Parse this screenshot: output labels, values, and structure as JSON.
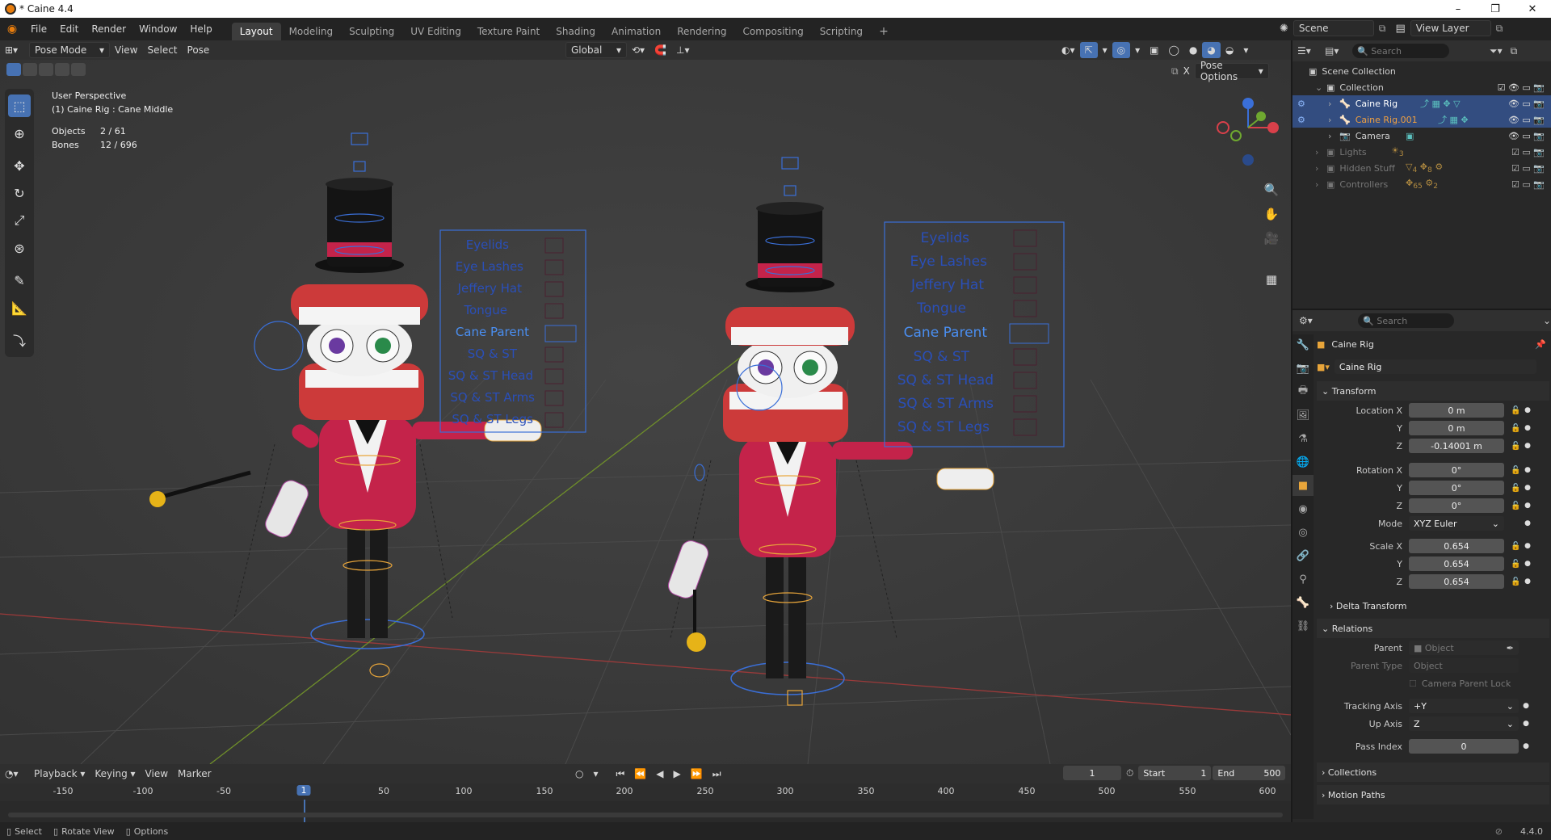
{
  "window": {
    "title": "* Caine 4.4"
  },
  "menus": [
    "File",
    "Edit",
    "Render",
    "Window",
    "Help"
  ],
  "workspace_tabs": [
    {
      "label": "Layout",
      "active": true
    },
    {
      "label": "Modeling"
    },
    {
      "label": "Sculpting"
    },
    {
      "label": "UV Editing"
    },
    {
      "label": "Texture Paint"
    },
    {
      "label": "Shading"
    },
    {
      "label": "Animation"
    },
    {
      "label": "Rendering"
    },
    {
      "label": "Compositing"
    },
    {
      "label": "Scripting"
    }
  ],
  "scene": {
    "name": "Scene",
    "view_layer": "View Layer"
  },
  "viewport": {
    "mode": "Pose Mode",
    "menus": [
      "View",
      "Select",
      "Pose"
    ],
    "orientation": "Global",
    "pose_options": "Pose Options",
    "overlay_title": "User Perspective",
    "overlay_subtitle": "(1) Caine Rig : Cane Middle",
    "stats": {
      "objects_label": "Objects",
      "objects_value": "2 / 61",
      "bones_label": "Bones",
      "bones_value": "12 / 696"
    },
    "control_panel_labels": [
      "Eyelids",
      "Eye Lashes",
      "Jeffery Hat",
      "Tongue",
      "Cane Parent",
      "SQ & ST",
      "SQ & ST Head",
      "SQ & ST Arms",
      "SQ & ST Legs"
    ]
  },
  "outliner": {
    "search_placeholder": "Search",
    "root": "Scene Collection",
    "items": [
      {
        "label": "Collection",
        "selected": false,
        "dim": false
      },
      {
        "label": "Caine Rig",
        "selected": true,
        "dim": false
      },
      {
        "label": "Caine Rig.001",
        "selected": true,
        "dim": false
      },
      {
        "label": "Camera",
        "selected": false,
        "dim": false
      },
      {
        "label": "Lights",
        "selected": false,
        "dim": true
      },
      {
        "label": "Hidden Stuff",
        "selected": false,
        "dim": true
      },
      {
        "label": "Controllers",
        "selected": false,
        "dim": true
      }
    ],
    "badges": {
      "lights": "3",
      "hidden_a": "4",
      "hidden_b": "8",
      "controllers_a": "65",
      "controllers_b": "2"
    }
  },
  "properties": {
    "search_placeholder": "Search",
    "object_name": "Caine Rig",
    "datablock_name": "Caine Rig",
    "transform": {
      "header": "Transform",
      "location_label": "Location X",
      "location": [
        "0 m",
        "0 m",
        "-0.14001 m"
      ],
      "rotation_label": "Rotation X",
      "rotation": [
        "0°",
        "0°",
        "0°"
      ],
      "mode_label": "Mode",
      "mode": "XYZ Euler",
      "scale_label": "Scale X",
      "scale": [
        "0.654",
        "0.654",
        "0.654"
      ],
      "y_label": "Y",
      "z_label": "Z"
    },
    "delta_transform": "Delta Transform",
    "relations": {
      "header": "Relations",
      "parent_label": "Parent",
      "parent_placeholder": "Object",
      "parent_type_label": "Parent Type",
      "parent_type": "Object",
      "camera_parent_lock": "Camera Parent Lock",
      "tracking_axis_label": "Tracking Axis",
      "tracking_axis": "+Y",
      "up_axis_label": "Up Axis",
      "up_axis": "Z",
      "pass_index_label": "Pass Index",
      "pass_index": "0"
    },
    "collections": "Collections",
    "motion_paths": "Motion Paths"
  },
  "timeline": {
    "menus": [
      "Playback",
      "Keying",
      "View",
      "Marker"
    ],
    "current_frame": "1",
    "start_label": "Start",
    "start": "1",
    "end_label": "End",
    "end": "500",
    "ruler": [
      "-150",
      "-100",
      "-50",
      "1",
      "50",
      "100",
      "150",
      "200",
      "250",
      "300",
      "350",
      "400",
      "450",
      "500",
      "550",
      "600"
    ]
  },
  "statusbar": {
    "select": "Select",
    "rotate": "Rotate View",
    "options": "Options",
    "version": "4.4.0"
  },
  "colors": {
    "accent": "#4772b3",
    "selected_row": "#334d80",
    "rig_orange": "#e8a53a",
    "bone_blue": "#3a6fd8"
  }
}
